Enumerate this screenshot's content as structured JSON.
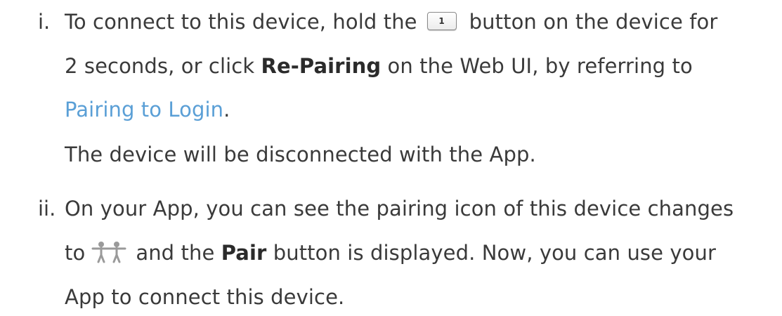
{
  "steps": [
    {
      "marker": "i.",
      "l1_a": "To connect to this device, hold the",
      "button_label": "1",
      "l1_b": "button on the device for",
      "l2_a": "2 seconds, or click ",
      "l2_bold": "Re-Pairing",
      "l2_b": " on the Web UI, by referring to",
      "l3_link": "Pairing to Login",
      "l3_end": ".",
      "l4": "The device will be disconnected with the App."
    },
    {
      "marker": "ii.",
      "l1": "On your App, you can see the pairing icon of this device changes",
      "l2_a": "to",
      "icon": "pairing-people-icon",
      "l2_b": "and the ",
      "l2_bold": "Pair",
      "l2_c": " button is displayed. Now, you can use your",
      "l3": "App to connect this device."
    }
  ]
}
